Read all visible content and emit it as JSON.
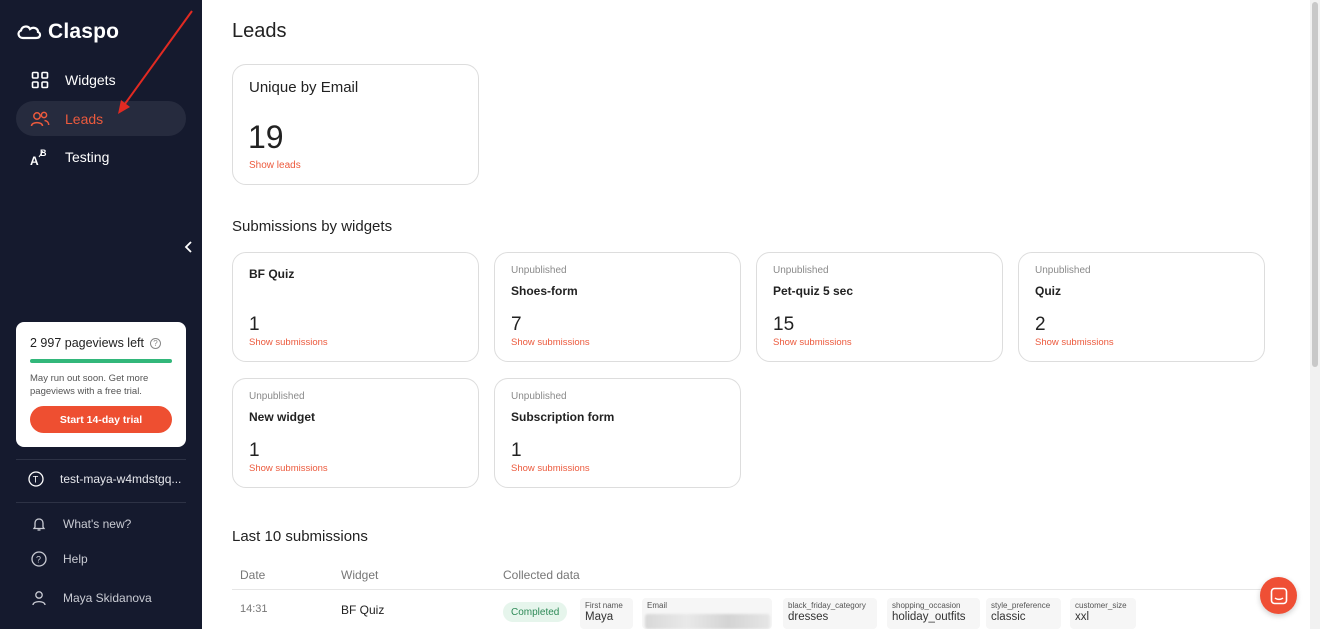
{
  "app": {
    "logo_text": "Claspo"
  },
  "sidebar": {
    "items": [
      {
        "label": "Widgets",
        "icon": "grid-icon"
      },
      {
        "label": "Leads",
        "icon": "users-icon",
        "active": true
      },
      {
        "label": "Testing",
        "icon": "ab-test-icon"
      }
    ],
    "pageviews": {
      "title": "2 997 pageviews left",
      "note": "May run out soon. Get more pageviews with a free trial.",
      "button": "Start 14-day trial",
      "fill": 1.0
    },
    "site": "test-maya-w4mdstgq...",
    "whats_new": "What's new?",
    "help": "Help",
    "user": "Maya Skidanova"
  },
  "main": {
    "title": "Leads",
    "unique": {
      "title": "Unique by Email",
      "count": "19",
      "link": "Show leads"
    },
    "submissions_title": "Submissions by widgets",
    "widgets": [
      {
        "status": "",
        "name": "BF Quiz",
        "count": "1",
        "link": "Show submissions"
      },
      {
        "status": "Unpublished",
        "name": "Shoes-form",
        "count": "7",
        "link": "Show submissions"
      },
      {
        "status": "Unpublished",
        "name": "Pet-quiz 5 sec",
        "count": "15",
        "link": "Show submissions"
      },
      {
        "status": "Unpublished",
        "name": "Quiz",
        "count": "2",
        "link": "Show submissions"
      },
      {
        "status": "Unpublished",
        "name": "New widget",
        "count": "1",
        "link": "Show submissions"
      },
      {
        "status": "Unpublished",
        "name": "Subscription form",
        "count": "1",
        "link": "Show submissions"
      }
    ],
    "last_title": "Last 10 submissions",
    "table": {
      "headers": [
        "Date",
        "Widget",
        "Collected data"
      ],
      "rows": [
        {
          "date": "14:31",
          "widget": "BF Quiz",
          "status": "Completed",
          "fields": [
            {
              "label": "First name",
              "value": "Maya"
            },
            {
              "label": "Email",
              "value": ""
            },
            {
              "label": "black_friday_category",
              "value": "dresses"
            },
            {
              "label": "shopping_occasion",
              "value": "holiday_outfits"
            },
            {
              "label": "style_preference",
              "value": "classic"
            },
            {
              "label": "customer_size",
              "value": "xxl"
            }
          ]
        }
      ]
    }
  },
  "colors": {
    "accent": "#ec5a3d",
    "sidebar_bg": "#151a2e",
    "progress": "#32b77a"
  }
}
